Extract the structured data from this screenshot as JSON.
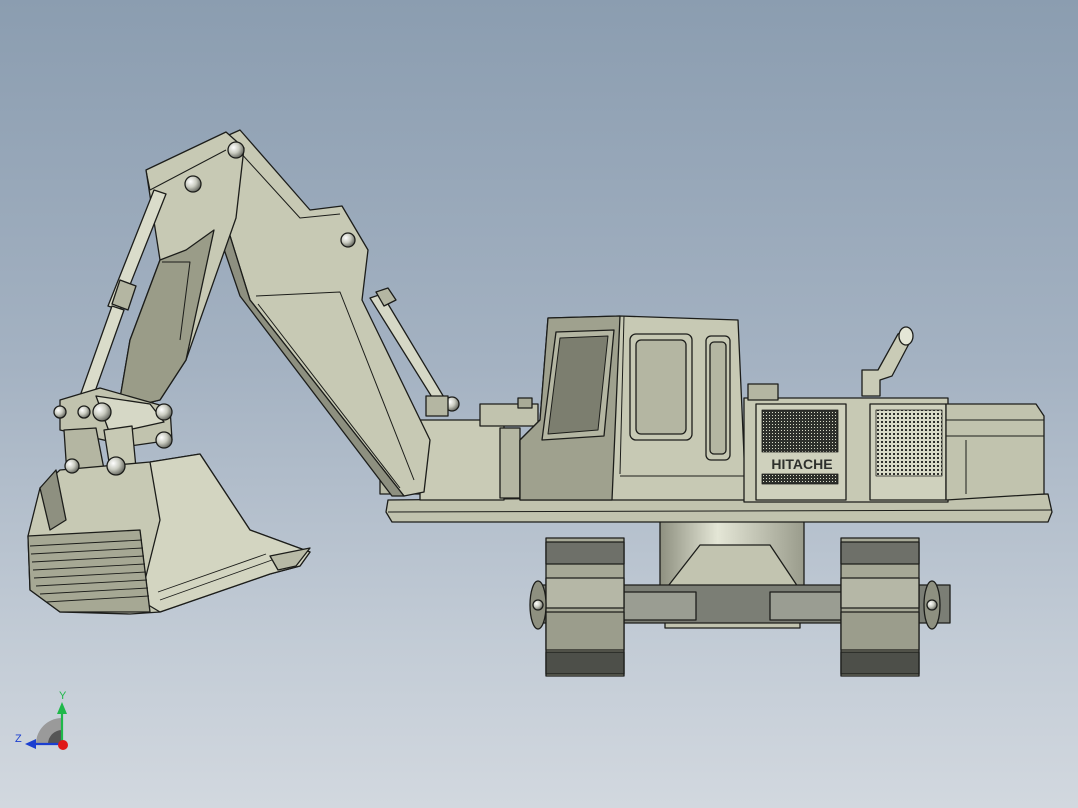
{
  "model": {
    "brand_decal": "HITACHE",
    "colors": {
      "body": "#c7c9b4",
      "body_light": "#d9dbc8",
      "body_shadow": "#8e9080",
      "dark": "#2e302c",
      "track": "#5c5f58",
      "edge": "#1c1d1a"
    }
  },
  "triad": {
    "y_label": "Y",
    "z_label": "Z",
    "colors": {
      "y": "#1fb84a",
      "z": "#1b3fd0",
      "x": "#e01818"
    }
  }
}
